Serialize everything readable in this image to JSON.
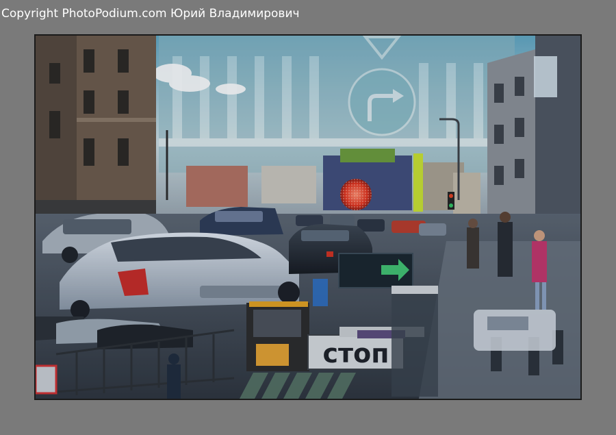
{
  "watermark": {
    "text": "Copyright PhotoPodium.com Юрий Владимирович"
  },
  "photo": {
    "sign_text": "стоп"
  },
  "colors": {
    "background": "#7a7a7a",
    "frame_border": "#1a1a1a"
  }
}
